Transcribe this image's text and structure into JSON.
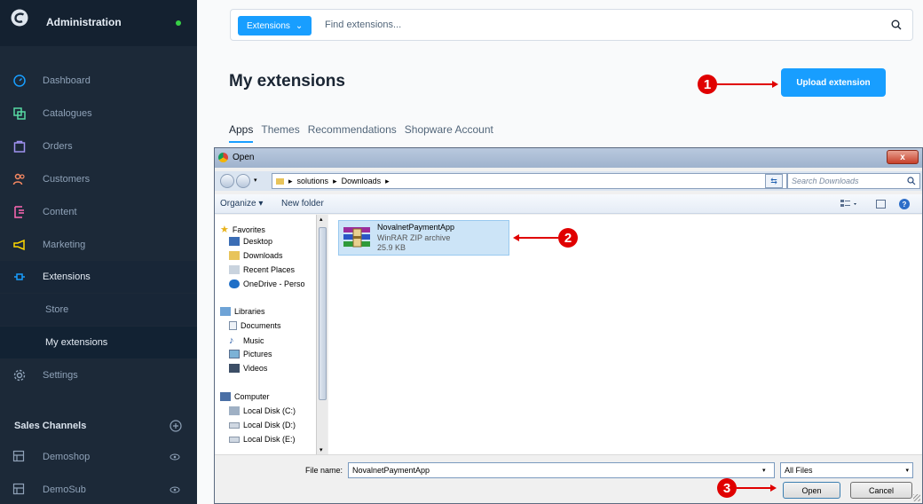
{
  "sidebar": {
    "title": "Administration",
    "items": [
      {
        "label": "Dashboard",
        "icon": "gauge-icon"
      },
      {
        "label": "Catalogues",
        "icon": "catalogue-icon"
      },
      {
        "label": "Orders",
        "icon": "bag-icon"
      },
      {
        "label": "Customers",
        "icon": "users-icon"
      },
      {
        "label": "Content",
        "icon": "content-icon"
      },
      {
        "label": "Marketing",
        "icon": "megaphone-icon"
      },
      {
        "label": "Extensions",
        "icon": "plug-icon"
      },
      {
        "label": "Store"
      },
      {
        "label": "My extensions"
      },
      {
        "label": "Settings",
        "icon": "gear-icon"
      }
    ],
    "sales_channels_title": "Sales Channels",
    "sales_channels": [
      {
        "label": "Demoshop"
      },
      {
        "label": "DemoSub"
      }
    ],
    "colors": {
      "background": "#1c2938",
      "status_dot": "#37d046"
    }
  },
  "main": {
    "search": {
      "filter_label": "Extensions",
      "placeholder": "Find extensions..."
    },
    "page_title": "My extensions",
    "upload_label": "Upload extension",
    "tabs": [
      {
        "label": "Apps"
      },
      {
        "label": "Themes"
      },
      {
        "label": "Recommendations"
      },
      {
        "label": "Shopware Account"
      }
    ],
    "accent": "#189eff"
  },
  "callouts": [
    "1",
    "2",
    "3"
  ],
  "dialog": {
    "title": "Open",
    "close_label": "x",
    "breadcrumb": [
      "solutions",
      "Downloads"
    ],
    "search_placeholder": "Search Downloads",
    "organize_label": "Organize ▾",
    "new_folder_label": "New folder",
    "help_label": "?",
    "nav": {
      "favorites_label": "Favorites",
      "favorites": [
        "Desktop",
        "Downloads",
        "Recent Places",
        "OneDrive - Perso"
      ],
      "libraries_label": "Libraries",
      "libraries": [
        "Documents",
        "Music",
        "Pictures",
        "Videos"
      ],
      "computer_label": "Computer",
      "drives": [
        "Local Disk (C:)",
        "Local Disk (D:)",
        "Local Disk (E:)"
      ]
    },
    "file": {
      "name": "NovalnetPaymentApp",
      "type": "WinRAR ZIP archive",
      "size": "25.9 KB"
    },
    "file_name_label": "File name:",
    "file_name_value": "NovalnetPaymentApp",
    "file_type_value": "All Files",
    "open_label": "Open",
    "cancel_label": "Cancel"
  }
}
